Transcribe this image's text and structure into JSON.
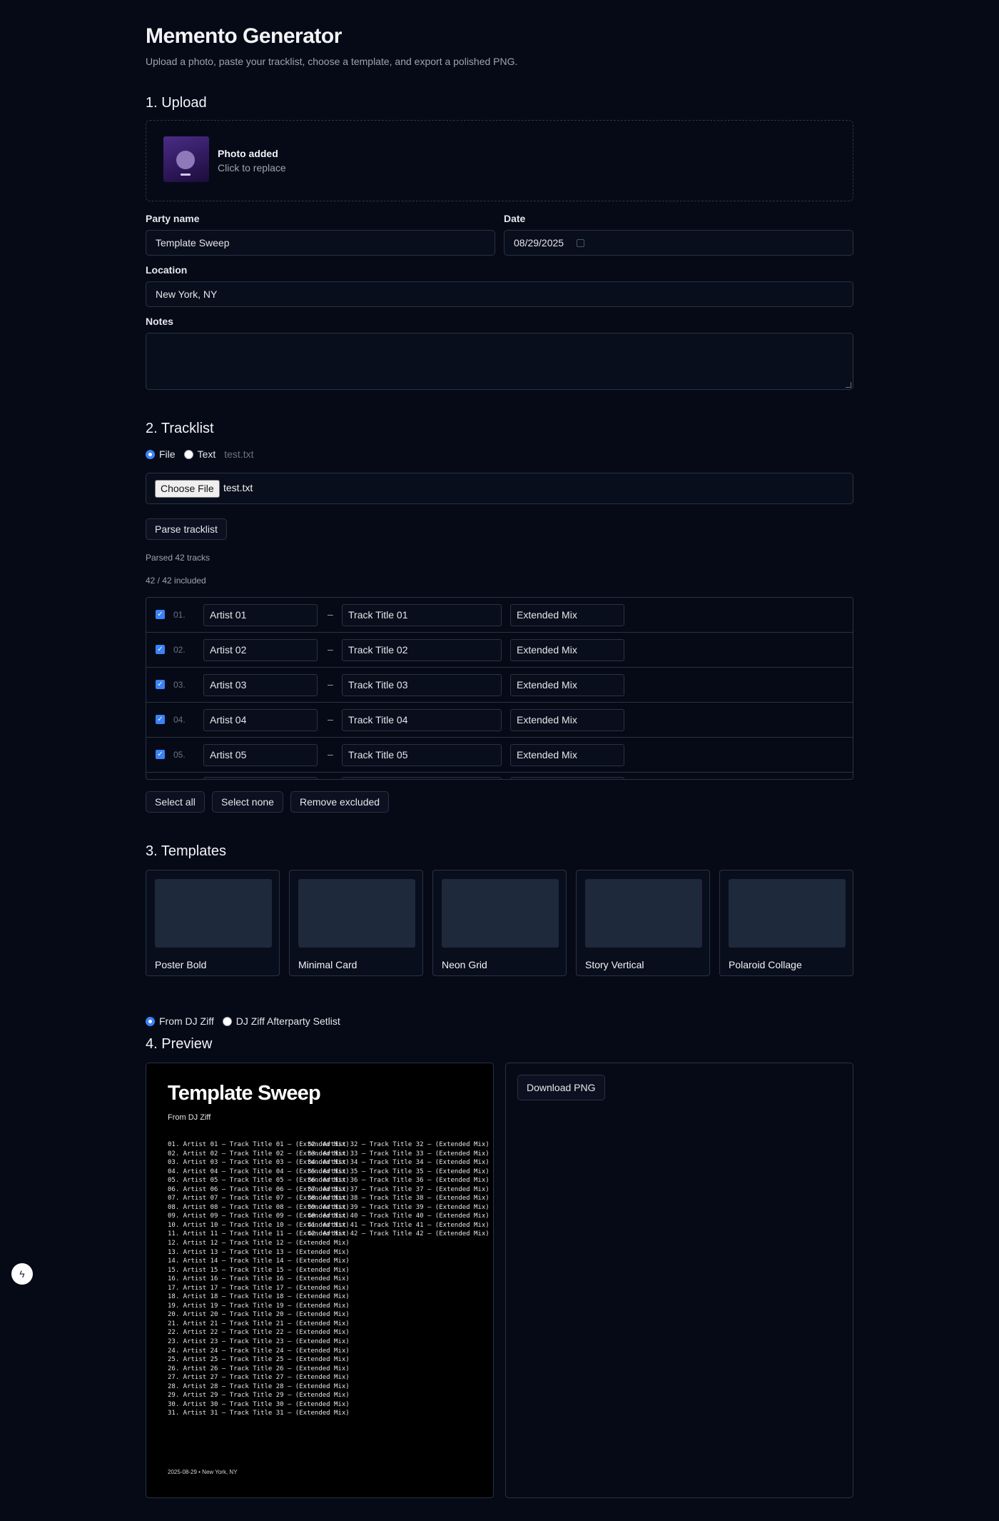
{
  "header": {
    "title": "Memento Generator",
    "subtitle": "Upload a photo, paste your tracklist, choose a template, and export a polished PNG."
  },
  "upload": {
    "section_title": "1. Upload",
    "photo_status": "Photo added",
    "photo_hint": "Click to replace",
    "party_name_label": "Party name",
    "party_name_value": "Template Sweep",
    "date_label": "Date",
    "date_value": "08/29/2025",
    "location_label": "Location",
    "location_value": "New York, NY",
    "notes_label": "Notes",
    "notes_value": ""
  },
  "tracklist": {
    "section_title": "2. Tracklist",
    "mode_file": "File",
    "mode_text": "Text",
    "selected_mode": "File",
    "current_file": "test.txt",
    "choose_file_label": "Choose File",
    "chosen_file_name": "test.txt",
    "parse_button": "Parse tracklist",
    "parsed_status": "Parsed 42 tracks",
    "included_status": "42 / 42 included",
    "rows": [
      {
        "num": "01.",
        "artist": "Artist 01",
        "title": "Track Title 01",
        "mix": "Extended Mix",
        "checked": true
      },
      {
        "num": "02.",
        "artist": "Artist 02",
        "title": "Track Title 02",
        "mix": "Extended Mix",
        "checked": true
      },
      {
        "num": "03.",
        "artist": "Artist 03",
        "title": "Track Title 03",
        "mix": "Extended Mix",
        "checked": true
      },
      {
        "num": "04.",
        "artist": "Artist 04",
        "title": "Track Title 04",
        "mix": "Extended Mix",
        "checked": true
      },
      {
        "num": "05.",
        "artist": "Artist 05",
        "title": "Track Title 05",
        "mix": "Extended Mix",
        "checked": true
      }
    ],
    "separator": "–",
    "select_all": "Select all",
    "select_none": "Select none",
    "remove_excluded": "Remove excluded"
  },
  "templates": {
    "section_title": "3. Templates",
    "items": [
      "Poster Bold",
      "Minimal Card",
      "Neon Grid",
      "Story Vertical",
      "Polaroid Collage"
    ],
    "attribution_options": [
      "From DJ Ziff",
      "DJ Ziff Afterparty Setlist"
    ],
    "selected_attribution": "From DJ Ziff"
  },
  "preview": {
    "section_title": "4. Preview",
    "poster_title": "Template Sweep",
    "poster_subtitle": "From DJ Ziff",
    "column_one": [
      "01. Artist 01 — Track Title 01 — (Extended Mix)",
      "02. Artist 02 — Track Title 02 — (Extended Mix)",
      "03. Artist 03 — Track Title 03 — (Extended Mix)",
      "04. Artist 04 — Track Title 04 — (Extended Mix)",
      "05. Artist 05 — Track Title 05 — (Extended Mix)",
      "06. Artist 06 — Track Title 06 — (Extended Mix)",
      "07. Artist 07 — Track Title 07 — (Extended Mix)",
      "08. Artist 08 — Track Title 08 — (Extended Mix)",
      "09. Artist 09 — Track Title 09 — (Extended Mix)",
      "10. Artist 10 — Track Title 10 — (Extended Mix)",
      "11. Artist 11 — Track Title 11 — (Extended Mix)",
      "12. Artist 12 — Track Title 12 — (Extended Mix)",
      "13. Artist 13 — Track Title 13 — (Extended Mix)",
      "14. Artist 14 — Track Title 14 — (Extended Mix)",
      "15. Artist 15 — Track Title 15 — (Extended Mix)",
      "16. Artist 16 — Track Title 16 — (Extended Mix)",
      "17. Artist 17 — Track Title 17 — (Extended Mix)",
      "18. Artist 18 — Track Title 18 — (Extended Mix)",
      "19. Artist 19 — Track Title 19 — (Extended Mix)",
      "20. Artist 20 — Track Title 20 — (Extended Mix)",
      "21. Artist 21 — Track Title 21 — (Extended Mix)",
      "22. Artist 22 — Track Title 22 — (Extended Mix)",
      "23. Artist 23 — Track Title 23 — (Extended Mix)",
      "24. Artist 24 — Track Title 24 — (Extended Mix)",
      "25. Artist 25 — Track Title 25 — (Extended Mix)",
      "26. Artist 26 — Track Title 26 — (Extended Mix)",
      "27. Artist 27 — Track Title 27 — (Extended Mix)",
      "28. Artist 28 — Track Title 28 — (Extended Mix)",
      "29. Artist 29 — Track Title 29 — (Extended Mix)",
      "30. Artist 30 — Track Title 30 — (Extended Mix)",
      "31. Artist 31 — Track Title 31 — (Extended Mix)"
    ],
    "column_two": [
      "32. Artist 32 — Track Title 32 — (Extended Mix)",
      "33. Artist 33 — Track Title 33 — (Extended Mix)",
      "34. Artist 34 — Track Title 34 — (Extended Mix)",
      "35. Artist 35 — Track Title 35 — (Extended Mix)",
      "36. Artist 36 — Track Title 36 — (Extended Mix)",
      "37. Artist 37 — Track Title 37 — (Extended Mix)",
      "38. Artist 38 — Track Title 38 — (Extended Mix)",
      "39. Artist 39 — Track Title 39 — (Extended Mix)",
      "40. Artist 40 — Track Title 40 — (Extended Mix)",
      "41. Artist 41 — Track Title 41 — (Extended Mix)",
      "42. Artist 42 — Track Title 42 — (Extended Mix)"
    ],
    "poster_footer": "2025-08-29 • New York, NY",
    "download_button": "Download PNG"
  },
  "colors": {
    "background": "#060a17",
    "border": "#2a3242",
    "accent": "#3b82f6",
    "template_thumb": "#1e293b"
  },
  "icons": {
    "floating_action": "bolt-icon",
    "date_picker": "calendar-icon"
  }
}
